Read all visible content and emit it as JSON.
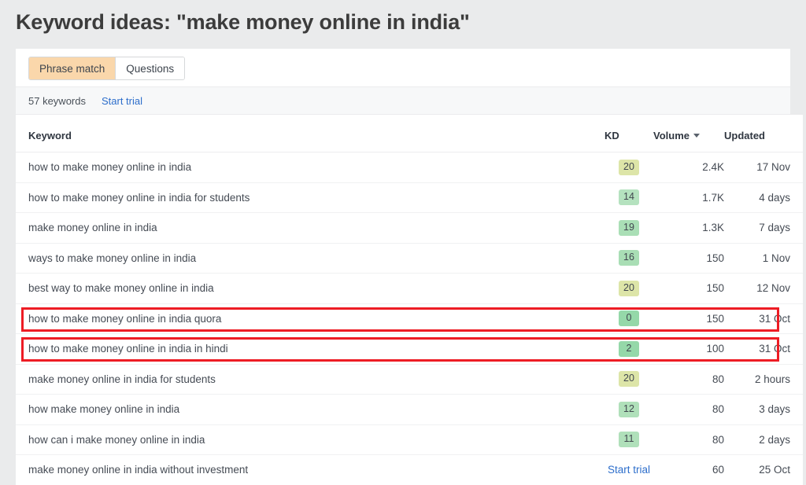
{
  "page": {
    "title": "Keyword ideas: \"make money online in india\""
  },
  "tabs": [
    {
      "label": "Phrase match",
      "active": true
    },
    {
      "label": "Questions",
      "active": false
    }
  ],
  "meta": {
    "keyword_count": "57 keywords",
    "trial_link": "Start trial"
  },
  "colors": {
    "page_background": "#eaebec",
    "card_background": "#ffffff",
    "active_tab": "#fad7ab",
    "link": "#2d6ecb",
    "highlight_border": "#ed1c24",
    "kd_easy": "#9fdcb0",
    "kd_medium": "#b4e0bb",
    "kd_harder": "#d8e3a4"
  },
  "table": {
    "columns": [
      {
        "label": "Keyword",
        "key": "keyword"
      },
      {
        "label": "KD",
        "key": "kd"
      },
      {
        "label": "Volume",
        "key": "volume",
        "sorted": "desc",
        "sort_icon": "caret-down-icon"
      },
      {
        "label": "Updated",
        "key": "updated"
      }
    ],
    "rows": [
      {
        "keyword": "how to make money online in india",
        "kd": "20",
        "kd_color": "#dde5a8",
        "volume": "2.4K",
        "updated": "17 Nov",
        "highlighted": false,
        "kd_is_link": false
      },
      {
        "keyword": "how to make money online in india for students",
        "kd": "14",
        "kd_color": "#b5e2bf",
        "volume": "1.7K",
        "updated": "4 days",
        "highlighted": false,
        "kd_is_link": false
      },
      {
        "keyword": "make money online in india",
        "kd": "19",
        "kd_color": "#aadfb6",
        "volume": "1.3K",
        "updated": "7 days",
        "highlighted": false,
        "kd_is_link": false
      },
      {
        "keyword": "ways to make money online in india",
        "kd": "16",
        "kd_color": "#a9deb5",
        "volume": "150",
        "updated": "1 Nov",
        "highlighted": false,
        "kd_is_link": false
      },
      {
        "keyword": "best way to make money online in india",
        "kd": "20",
        "kd_color": "#dde5a8",
        "volume": "150",
        "updated": "12 Nov",
        "highlighted": false,
        "kd_is_link": false
      },
      {
        "keyword": "how to make money online in india quora",
        "kd": "0",
        "kd_color": "#95d8a9",
        "volume": "150",
        "updated": "31 Oct",
        "highlighted": true,
        "kd_is_link": false
      },
      {
        "keyword": "how to make money online in india in hindi",
        "kd": "2",
        "kd_color": "#95d8a9",
        "volume": "100",
        "updated": "31 Oct",
        "highlighted": true,
        "kd_is_link": false
      },
      {
        "keyword": "make money online in india for students",
        "kd": "20",
        "kd_color": "#dde5a8",
        "volume": "80",
        "updated": "2 hours",
        "highlighted": false,
        "kd_is_link": false
      },
      {
        "keyword": "how make money online in india",
        "kd": "12",
        "kd_color": "#b0e0ba",
        "volume": "80",
        "updated": "3 days",
        "highlighted": false,
        "kd_is_link": false
      },
      {
        "keyword": "how can i make money online in india",
        "kd": "11",
        "kd_color": "#b0e0ba",
        "volume": "80",
        "updated": "2 days",
        "highlighted": false,
        "kd_is_link": false
      },
      {
        "keyword": "make money online in india without investment",
        "kd": "Start trial",
        "kd_color": "",
        "volume": "60",
        "updated": "25 Oct",
        "highlighted": false,
        "kd_is_link": true
      }
    ]
  }
}
